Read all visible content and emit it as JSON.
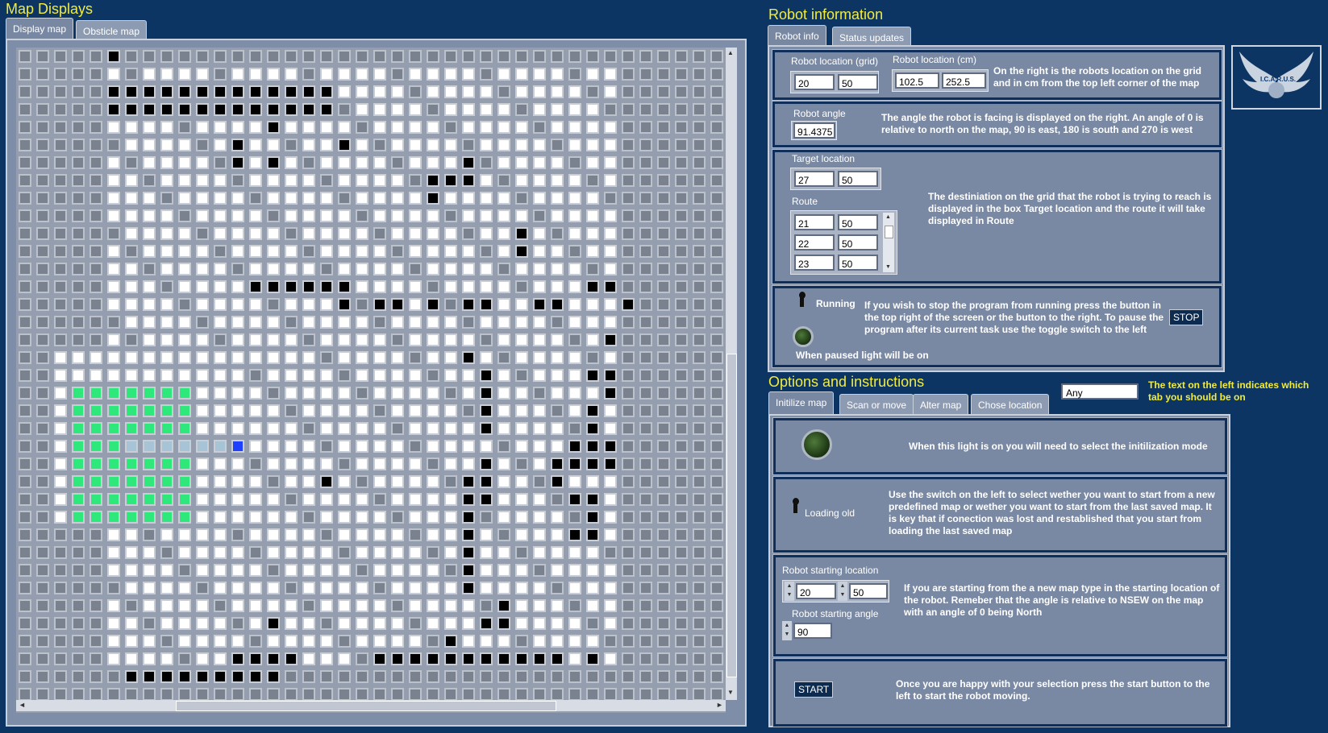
{
  "map_displays": {
    "title": "Map Displays",
    "tabs": [
      "Display map",
      "Obsticle map"
    ],
    "legend_colors": {
      "unknown": "#7a8290",
      "free": "#ffffff",
      "obstacle": "#000000",
      "scanned": "#2ee87c",
      "route": "#a7c4d6",
      "robot": "#1f3fff"
    }
  },
  "robot_info": {
    "title": "Robot information",
    "tabs": [
      "Robot info",
      "Status updates"
    ],
    "location_grid_label": "Robot location (grid)",
    "location_grid": [
      "20",
      "50"
    ],
    "location_cm_label": "Robot location (cm)",
    "location_cm": [
      "102.5",
      "252.5"
    ],
    "location_desc": "On the right is the robots location on the grid and in cm from the top left corner of the map",
    "angle_label": "Robot angle",
    "angle": "91.4375",
    "angle_desc": "The angle the robot is facing is displayed on the right. An angle of 0 is relative to north on the map, 90 is east, 180 is south and 270 is west",
    "target_label": "Target location",
    "target": [
      "27",
      "50"
    ],
    "route_label": "Route",
    "route": [
      [
        "21",
        "50"
      ],
      [
        "22",
        "50"
      ],
      [
        "23",
        "50"
      ]
    ],
    "target_desc": "The destiniation on the grid that the robot is trying to reach is displayed in the box Target location and the route it will take displayed in Route",
    "running_label": "Running",
    "running_desc": "If you wish to stop the program from running press the button in the top right of the screen or the button to the right. To pause the program after its current task use the toggle switch to the left",
    "stop_label": "STOP",
    "paused_label": "When paused light will be on"
  },
  "logo": {
    "text": "I.C.A.R.U.S."
  },
  "options": {
    "title": "Options and instructions",
    "tabs": [
      "Initilize map",
      "Scan or move",
      "Alter map",
      "Chose location"
    ],
    "tab_indicator": "Any",
    "tab_indicator_desc": "The text on the left indicates which tab you should be on",
    "init_light_desc": "When this light is on you will need to select the initilization mode",
    "loading_label": "Loading old",
    "loading_desc": "Use the switch on the left to select wether you want to start from a new predefined map or wether you want to start from the last saved map. It is key that if conection was lost and restablished that you start from loading the last saved map",
    "start_loc_label": "Robot starting location",
    "start_loc": [
      "20",
      "50"
    ],
    "start_angle_label": "Robot starting angle",
    "start_angle": "90",
    "start_desc": "If you are starting from the a new map type in the starting location of the robot. Remeber that the angle is relative to NSEW on the map with an angle of 0 being North",
    "start_button": "START",
    "start_button_desc": "Once you are happy with your selection press the start button to the left to start the robot moving."
  }
}
